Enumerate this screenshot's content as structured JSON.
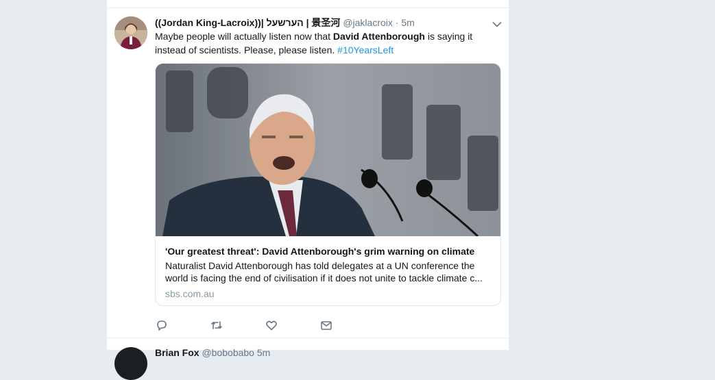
{
  "tweet": {
    "display_name": "((Jordan King-Lacroix))| הערשעל | 景圣河",
    "handle": "@jaklacroix",
    "separator": "·",
    "time": "5m",
    "text_before": "Maybe people will actually listen now that ",
    "text_bold": "David Attenborough",
    "text_after": " is saying it instead of scientists. Please, please listen. ",
    "hashtag": "#10YearsLeft",
    "card": {
      "title": "'Our greatest threat': David Attenborough's grim warning on climate",
      "description": "Naturalist David Attenborough has told delegates at a UN conference the world is facing the end of civilisation if it does not unite to tackle climate c...",
      "domain": "sbs.com.au"
    },
    "actions": [
      "reply-icon",
      "retweet-icon",
      "like-icon",
      "direct-message-icon"
    ]
  },
  "next_tweet": {
    "display_name": "Brian Fox",
    "handle": "@bobobabo",
    "time": "5m"
  },
  "colors": {
    "link": "#1b95e0",
    "secondary_text": "#657786",
    "background": "#e6ecf0"
  }
}
